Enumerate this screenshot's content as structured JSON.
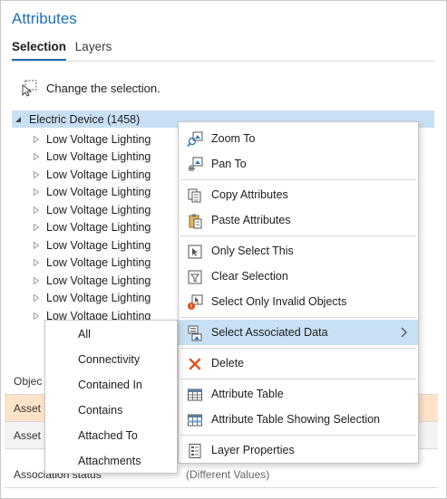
{
  "panel": {
    "title": "Attributes",
    "tabs": [
      {
        "label": "Selection",
        "active": true
      },
      {
        "label": "Layers",
        "active": false
      }
    ],
    "change_selection_label": "Change the selection.",
    "change_selection_icon": "select-arrow-icon"
  },
  "tree": {
    "root": {
      "label": "Electric Device (1458)",
      "expanded": true
    },
    "items": [
      "Low Voltage Lighting",
      "Low Voltage Lighting",
      "Low Voltage Lighting",
      "Low Voltage Lighting",
      "Low Voltage Lighting",
      "Low Voltage Lighting",
      "Low Voltage Lighting",
      "Low Voltage Lighting",
      "Low Voltage Lighting",
      "Low Voltage Lighting",
      "Low Voltage Lighting"
    ]
  },
  "grid": {
    "rows": [
      {
        "key": "Objec",
        "value": ""
      },
      {
        "key": "Asset",
        "value": ""
      },
      {
        "key": "Asset",
        "value": ""
      },
      {
        "key": "Association status",
        "value": "(Different Values)"
      }
    ]
  },
  "context_menu": {
    "items": [
      {
        "label": "Zoom To",
        "icon": "zoom-to-icon"
      },
      {
        "label": "Pan To",
        "icon": "pan-to-icon"
      },
      {
        "label": "Copy Attributes",
        "icon": "copy-icon"
      },
      {
        "label": "Paste Attributes",
        "icon": "paste-icon"
      },
      {
        "label": "Only Select This",
        "icon": "select-only-icon"
      },
      {
        "label": "Clear Selection",
        "icon": "clear-selection-icon"
      },
      {
        "label": "Select Only Invalid Objects",
        "icon": "invalid-objects-icon"
      },
      {
        "label": "Select Associated Data",
        "icon": "associated-data-icon",
        "submenu": true,
        "highlighted": true
      },
      {
        "label": "Delete",
        "icon": "delete-icon"
      },
      {
        "label": "Attribute Table",
        "icon": "table-icon"
      },
      {
        "label": "Attribute Table Showing Selection",
        "icon": "table-selection-icon"
      },
      {
        "label": "Layer Properties",
        "icon": "layer-properties-icon"
      }
    ]
  },
  "submenu": {
    "items": [
      "All",
      "Connectivity",
      "Contained In",
      "Contains",
      "Attached To",
      "Attachments"
    ]
  },
  "colors": {
    "accent": "#1d6fb8",
    "selection": "#c8e0f4",
    "row_highlight": "#fde3c8",
    "delete": "#d9541e"
  }
}
